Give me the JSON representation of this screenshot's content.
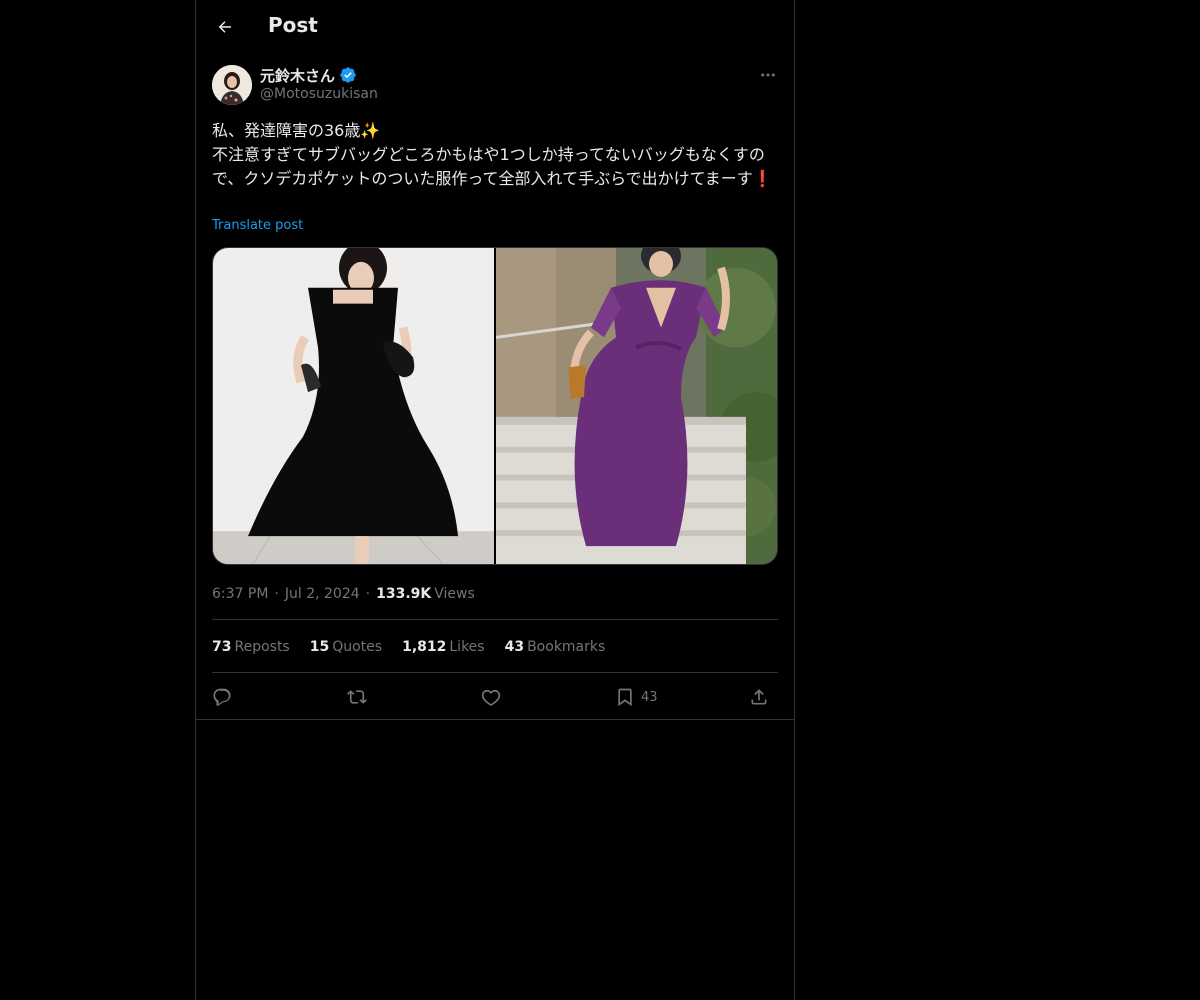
{
  "header": {
    "title": "Post",
    "back_icon": "arrow-left-icon"
  },
  "author": {
    "display_name": "元鈴木さん",
    "handle": "@Motosuzukisan",
    "verified": true,
    "verified_color": "#1d9bf0"
  },
  "post": {
    "text": "私、発達障害の36歳✨\n不注意すぎてサブバッグどころかもはや1つしか持ってないバッグもなくすので、クソデカポケットのついた服作って全部入れて手ぶらで出かけてまーす❗",
    "translate_label": "Translate post",
    "media": [
      {
        "description_icon": "black-dress-photo",
        "dominant_color": "#0b0b0b"
      },
      {
        "description_icon": "purple-dress-photo",
        "dominant_color": "#6b2f7a"
      }
    ]
  },
  "meta": {
    "time": "6:37 PM",
    "date": "Jul 2, 2024",
    "views_count": "133.9K",
    "views_label": "Views"
  },
  "stats": {
    "reposts_count": "73",
    "reposts_label": "Reposts",
    "quotes_count": "15",
    "quotes_label": "Quotes",
    "likes_count": "1,812",
    "likes_label": "Likes",
    "bookmarks_count": "43",
    "bookmarks_label": "Bookmarks"
  },
  "actions": {
    "reply_icon": "reply-icon",
    "repost_icon": "repost-icon",
    "like_icon": "heart-icon",
    "bookmark_icon": "bookmark-icon",
    "bookmark_count": "43",
    "share_icon": "share-icon"
  },
  "colors": {
    "background": "#000000",
    "text_primary": "#e7e9ea",
    "text_secondary": "#71767b",
    "border": "#2f3336",
    "link": "#1d9bf0"
  }
}
